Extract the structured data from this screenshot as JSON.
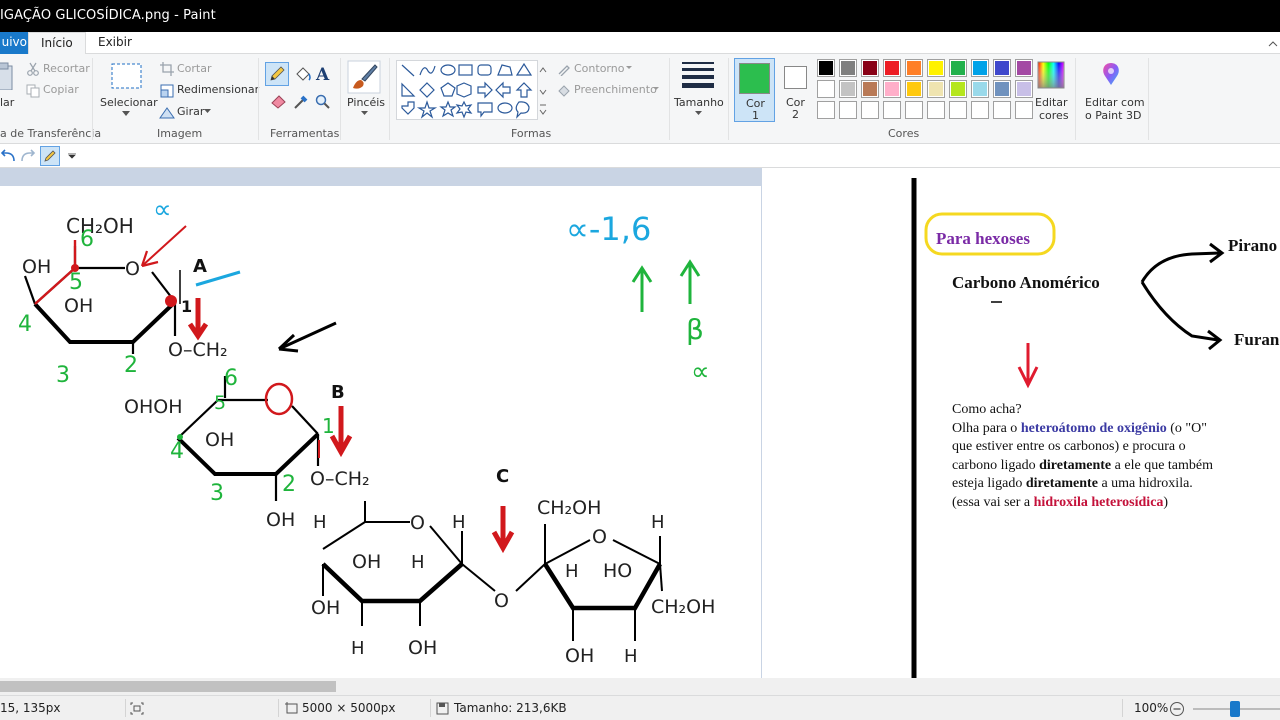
{
  "window": {
    "title": "IGAÇÃO GLICOSÍDICA.png - Paint"
  },
  "menu": {
    "file": "uivo",
    "home": "Início",
    "view": "Exibir"
  },
  "ribbon": {
    "clipboard": {
      "paste": "lar",
      "cut": "Recortar",
      "copy": "Copiar",
      "group": "a de Transferência"
    },
    "image": {
      "select": "Selecionar",
      "crop": "Cortar",
      "resize": "Redimensionar",
      "rotate": "Girar",
      "group": "Imagem"
    },
    "tools": {
      "group": "Ferramentas"
    },
    "brushes": {
      "label": "Pincéis"
    },
    "shapes": {
      "outline": "Contorno",
      "fill": "Preenchimento",
      "group": "Formas"
    },
    "size": {
      "label": "Tamanho"
    },
    "colors": {
      "color1": "Cor\n1",
      "color1_a": "Cor",
      "color1_b": "1",
      "color2_a": "Cor",
      "color2_b": "2",
      "edit_a": "Editar",
      "edit_b": "cores",
      "paint3d_a": "Editar com",
      "paint3d_b": "o Paint 3D",
      "group": "Cores",
      "primary": "#2cbe4e",
      "secondary": "#ffffff",
      "palette_row1": [
        "#000000",
        "#7f7f7f",
        "#880015",
        "#ed1c24",
        "#ff7f27",
        "#fff200",
        "#22b14c",
        "#00a2e8",
        "#3f48cc",
        "#a349a4"
      ],
      "palette_row2": [
        "#ffffff",
        "#c3c3c3",
        "#b97a57",
        "#ffaec9",
        "#ffc90e",
        "#efe4b0",
        "#b5e61d",
        "#99d9ea",
        "#7092be",
        "#c8bfe7"
      ]
    }
  },
  "drawing": {
    "alpha_top": "∝",
    "alpha16": "∝-1,6",
    "beta": "β",
    "alpha_small": "∝",
    "labels": {
      "A": "A",
      "B": "B",
      "C": "C"
    },
    "ring1": {
      "ch2oh": "CH₂OH",
      "oh_left": "OH",
      "o": "O",
      "oh_mid": "OH"
    },
    "link1": {
      "o_ch2": "O–CH₂"
    },
    "ring2": {
      "oh_oh": "OHOH",
      "o": "O",
      "oh_mid": "OH",
      "oh_bottom": "OH",
      "o_ch2": "O–CH₂"
    },
    "ring3": {
      "h1": "H",
      "o": "O",
      "h2": "H",
      "oh1": "OH",
      "h3": "H",
      "oh2": "OH",
      "h4": "H",
      "oh3": "OH"
    },
    "bridge_o": "O",
    "ring4": {
      "ch2oh_top": "CH₂OH",
      "o": "O",
      "h1": "H",
      "h2": "H",
      "ho": "HO",
      "ch2oh_right": "CH₂OH",
      "oh": "OH",
      "h3": "H"
    },
    "numbers_green": [
      "6",
      "5",
      "4",
      "3",
      "2",
      "6",
      "5",
      "4",
      "3",
      "2"
    ]
  },
  "notes": {
    "box_label": "Para hexoses",
    "anomeric": "Carbono Anomérico",
    "pyranose": "Pirano",
    "furanose": "Furan",
    "paragraph": {
      "p1": "Como acha?",
      "p2a": "Olha para o ",
      "p2b": "heteroátomo de oxigênio",
      "p2c": " (o \"O\" que estiver entre os carbonos) e procura o carbono ligado ",
      "p2d": "diretamente",
      "p2e": " a ele que também esteja ligado ",
      "p2f": "diretamente",
      "p2g": " a uma hidroxila. (essa vai ser a ",
      "p2h": "hidroxila heterosídica",
      "p2i": ")"
    }
  },
  "status": {
    "cursor": "15, 135px",
    "dimensions": "5000 × 5000px",
    "size": "Tamanho: 213,6KB",
    "zoom": "100%"
  }
}
